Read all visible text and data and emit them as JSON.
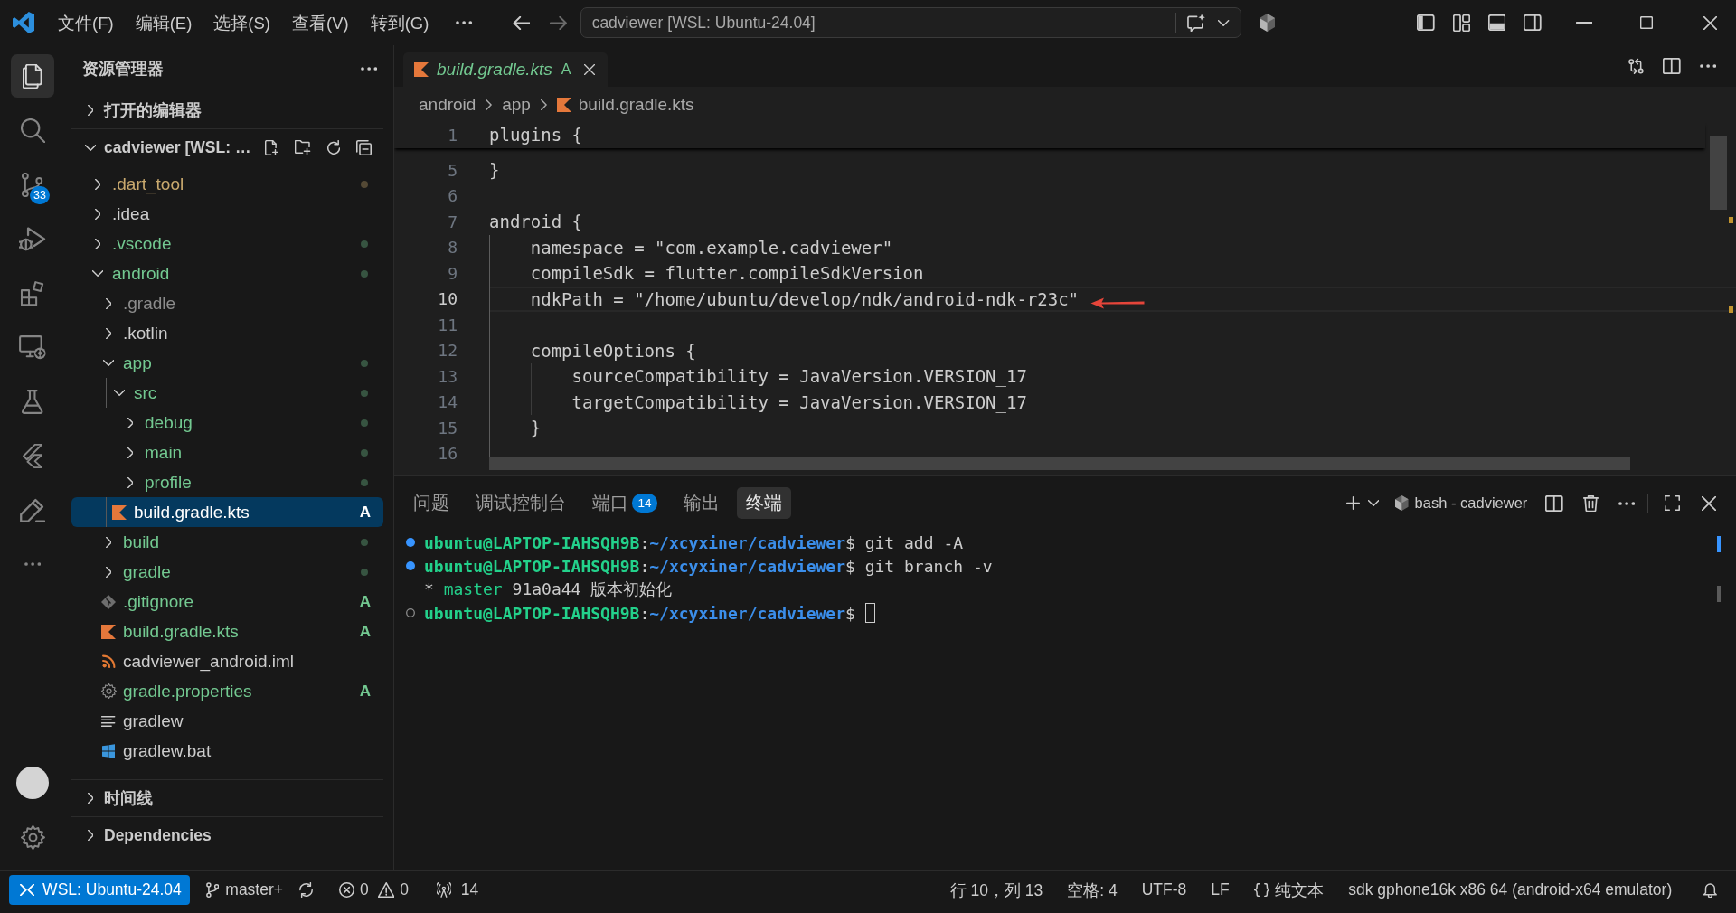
{
  "title_bar": {
    "menus": [
      "文件(F)",
      "编辑(E)",
      "选择(S)",
      "查看(V)",
      "转到(G)"
    ],
    "command_center": "cadviewer [WSL: Ubuntu-24.04]"
  },
  "activity_bar": {
    "items": [
      {
        "kind": "explorer",
        "selected": true
      },
      {
        "kind": "search",
        "selected": false
      },
      {
        "kind": "source-control",
        "selected": false,
        "badge": "33"
      },
      {
        "kind": "run-debug",
        "selected": false
      },
      {
        "kind": "extensions",
        "selected": false
      },
      {
        "kind": "remote",
        "selected": false
      },
      {
        "kind": "testing",
        "selected": false
      },
      {
        "kind": "flutter",
        "selected": false
      },
      {
        "kind": "pen",
        "selected": false
      },
      {
        "kind": "more",
        "selected": false
      }
    ],
    "bottom": [
      {
        "kind": "account"
      },
      {
        "kind": "settings"
      }
    ]
  },
  "sidebar": {
    "title": "资源管理器",
    "sections": [
      {
        "label": "打开的编辑器",
        "expanded": false
      },
      {
        "label": "cadviewer [WSL: …",
        "expanded": true,
        "tree": [
          {
            "name": ".dart_tool",
            "kind": "folder",
            "expanded": false,
            "color": "#c9a96e",
            "dot": true,
            "selected": false
          },
          {
            "name": ".idea",
            "kind": "folder",
            "expanded": false,
            "color": "#cccccc",
            "dot": false,
            "selected": false
          },
          {
            "name": ".vscode",
            "kind": "folder",
            "expanded": false,
            "color": "#73c991",
            "dot": true,
            "selected": false
          },
          {
            "name": "android",
            "kind": "folder",
            "expanded": true,
            "color": "#73c991",
            "dot": true,
            "selected": false,
            "children": [
              {
                "name": ".gradle",
                "kind": "folder",
                "expanded": false,
                "color": "#8c8c8c",
                "dot": false,
                "selected": false
              },
              {
                "name": ".kotlin",
                "kind": "folder",
                "expanded": false,
                "color": "#cccccc",
                "dot": false,
                "selected": false
              },
              {
                "name": "app",
                "kind": "folder",
                "expanded": true,
                "color": "#73c991",
                "dot": true,
                "selected": false,
                "children": [
                  {
                    "name": "src",
                    "kind": "folder",
                    "expanded": true,
                    "color": "#73c991",
                    "dot": true,
                    "selected": false,
                    "children": [
                      {
                        "name": "debug",
                        "kind": "folder",
                        "expanded": false,
                        "color": "#73c991",
                        "dot": true,
                        "selected": false
                      },
                      {
                        "name": "main",
                        "kind": "folder",
                        "expanded": false,
                        "color": "#73c991",
                        "dot": true,
                        "selected": false
                      },
                      {
                        "name": "profile",
                        "kind": "folder",
                        "expanded": false,
                        "color": "#73c991",
                        "dot": true,
                        "selected": false
                      }
                    ]
                  },
                  {
                    "name": "build.gradle.kts",
                    "kind": "kotlin",
                    "color": "#ffffff",
                    "badge": "A",
                    "dot": false,
                    "selected": true
                  }
                ]
              },
              {
                "name": "build",
                "kind": "folder",
                "expanded": false,
                "color": "#73c991",
                "dot": true,
                "selected": false
              },
              {
                "name": "gradle",
                "kind": "folder",
                "expanded": false,
                "color": "#73c991",
                "dot": true,
                "selected": false
              },
              {
                "name": ".gitignore",
                "kind": "gitignore",
                "color": "#73c991",
                "badge": "A",
                "dot": false,
                "selected": false
              },
              {
                "name": "build.gradle.kts",
                "kind": "kotlin",
                "color": "#73c991",
                "badge": "A",
                "dot": false,
                "selected": false
              },
              {
                "name": "cadviewer_android.iml",
                "kind": "iml",
                "color": "#cccccc",
                "dot": false,
                "selected": false
              },
              {
                "name": "gradle.properties",
                "kind": "properties",
                "color": "#73c991",
                "badge": "A",
                "dot": false,
                "selected": false
              },
              {
                "name": "gradlew",
                "kind": "script",
                "color": "#cccccc",
                "dot": false,
                "selected": false
              },
              {
                "name": "gradlew.bat",
                "kind": "batch",
                "color": "#cccccc",
                "dot": false,
                "selected": false
              }
            ]
          }
        ]
      },
      {
        "label": "时间线",
        "expanded": false
      },
      {
        "label": "Dependencies",
        "expanded": false
      }
    ]
  },
  "editor": {
    "tabs": [
      {
        "label": "build.gradle.kts",
        "kind": "kotlin",
        "selected": true,
        "preview": true,
        "color": "#73c991",
        "badge": "A"
      }
    ],
    "breadcrumbs": [
      {
        "label": "android",
        "kind": "folder"
      },
      {
        "label": "app",
        "kind": "folder"
      },
      {
        "label": "build.gradle.kts",
        "kind": "kotlin"
      }
    ],
    "sticky_line": {
      "number": "1",
      "text": "plugins {"
    },
    "lines": [
      {
        "number": "5",
        "text": "}",
        "current": false
      },
      {
        "number": "6",
        "current": false
      },
      {
        "number": "7",
        "text": "android {",
        "current": false
      },
      {
        "number": "8",
        "text": "    namespace = \"com.example.cadviewer\"",
        "current": false
      },
      {
        "number": "9",
        "text": "    compileSdk = flutter.compileSdkVersion",
        "current": false
      },
      {
        "number": "10",
        "text": "    ndkPath = \"/home/ubuntu/develop/ndk/android-ndk-r23c\"",
        "current": true
      },
      {
        "number": "11",
        "current": false
      },
      {
        "number": "12",
        "text": "    compileOptions {",
        "current": false
      },
      {
        "number": "13",
        "text": "        sourceCompatibility = JavaVersion.VERSION_17",
        "current": false
      },
      {
        "number": "14",
        "text": "        targetCompatibility = JavaVersion.VERSION_17",
        "current": false
      },
      {
        "number": "15",
        "text": "    }",
        "current": false
      },
      {
        "number": "16",
        "current": false
      }
    ]
  },
  "panel": {
    "tabs": [
      {
        "label": "问题",
        "selected": false
      },
      {
        "label": "调试控制台",
        "selected": false
      },
      {
        "label": "端口",
        "selected": false,
        "badge": "14"
      },
      {
        "label": "输出",
        "selected": false
      },
      {
        "label": "终端",
        "selected": true
      }
    ],
    "terminal_tab": "bash - cadviewer",
    "terminal": {
      "lines": [
        {
          "kind": "success",
          "cursor": false,
          "segments": [
            {
              "kind": "host",
              "text": "ubuntu@LAPTOP-IAHSQH9B"
            },
            {
              "kind": "plain",
              "text": ":"
            },
            {
              "kind": "path",
              "text": "~/xcyxiner/cadviewer"
            },
            {
              "kind": "plain",
              "text": "$ git add -A"
            }
          ]
        },
        {
          "kind": "success",
          "cursor": false,
          "segments": [
            {
              "kind": "host",
              "text": "ubuntu@LAPTOP-IAHSQH9B"
            },
            {
              "kind": "plain",
              "text": ":"
            },
            {
              "kind": "path",
              "text": "~/xcyxiner/cadviewer"
            },
            {
              "kind": "plain",
              "text": "$ git branch -v"
            }
          ]
        },
        {
          "kind": "output",
          "cursor": false,
          "segments": [
            {
              "kind": "plain",
              "text": "* "
            },
            {
              "kind": "branch",
              "text": "master"
            },
            {
              "kind": "plain",
              "text": " 91a0a44 版本初始化"
            }
          ]
        },
        {
          "kind": "pending",
          "cursor": true,
          "segments": [
            {
              "kind": "host",
              "text": "ubuntu@LAPTOP-IAHSQH9B"
            },
            {
              "kind": "plain",
              "text": ":"
            },
            {
              "kind": "path",
              "text": "~/xcyxiner/cadviewer"
            },
            {
              "kind": "plain",
              "text": "$ "
            }
          ]
        }
      ]
    }
  },
  "status_bar": {
    "left": [
      {
        "kind": "remote",
        "text": "WSL: Ubuntu-24.04"
      },
      {
        "kind": "branch",
        "text": "master+"
      },
      {
        "kind": "sync"
      },
      {
        "kind": "problems",
        "errors": "0",
        "warnings": "0"
      },
      {
        "kind": "ports",
        "text": "14"
      }
    ],
    "right": [
      {
        "kind": "text",
        "text": "行 10，列 13"
      },
      {
        "kind": "text",
        "text": "空格: 4"
      },
      {
        "kind": "text",
        "text": "UTF-8"
      },
      {
        "kind": "text",
        "text": "LF"
      },
      {
        "kind": "language",
        "text": "纯文本"
      },
      {
        "kind": "text",
        "text": "sdk gphone16k x86 64 (android-x64 emulator)"
      },
      {
        "kind": "notifications"
      }
    ]
  }
}
